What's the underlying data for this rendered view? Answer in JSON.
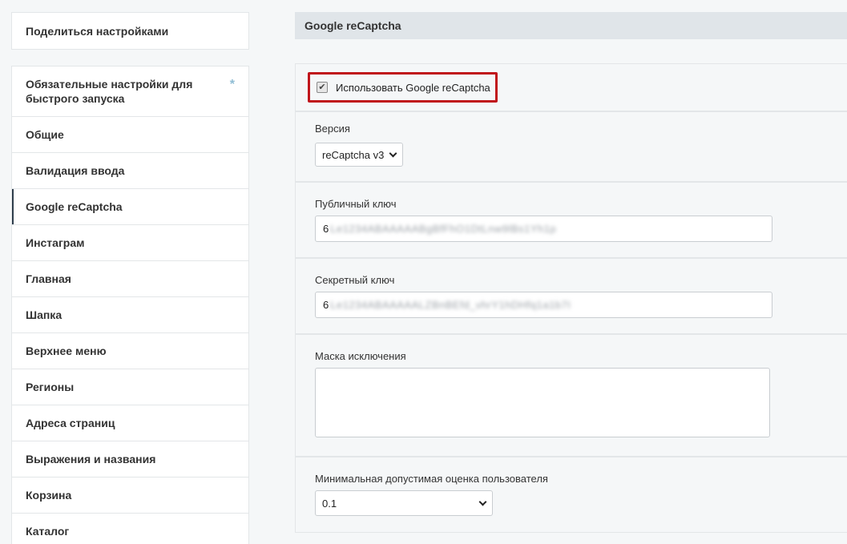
{
  "sidebar": {
    "share_label": "Поделиться настройками",
    "items": [
      {
        "label": "Обязательные настройки для быстрого запуска",
        "marker": "*"
      },
      {
        "label": "Общие"
      },
      {
        "label": "Валидация ввода"
      },
      {
        "label": "Google reCaptcha",
        "active": true
      },
      {
        "label": "Инстаграм"
      },
      {
        "label": "Главная"
      },
      {
        "label": "Шапка"
      },
      {
        "label": "Верхнее меню"
      },
      {
        "label": "Регионы"
      },
      {
        "label": "Адреса страниц"
      },
      {
        "label": "Выражения и названия"
      },
      {
        "label": "Корзина"
      },
      {
        "label": "Каталог"
      }
    ]
  },
  "main": {
    "section_title": "Google reCaptcha",
    "use_recaptcha": {
      "label": "Использовать Google reCaptcha",
      "checked": true
    },
    "version": {
      "label": "Версия",
      "value": "reCaptcha v3"
    },
    "public_key": {
      "label": "Публичный ключ",
      "value_prefix": "6",
      "value_masked": "Le1234ABAAAAABgBfFhO1DtLnw9lBs1Yh1p"
    },
    "secret_key": {
      "label": "Секретный ключ",
      "value_prefix": "6",
      "value_masked": "Le1234ABAAAAALZBnBEfd_vhrY1hDHfq1a1b7I"
    },
    "exclusion_mask": {
      "label": "Маска исключения",
      "value": ""
    },
    "min_score": {
      "label": "Минимальная допустимая оценка пользователя",
      "value": "0.1"
    }
  },
  "colors": {
    "highlight_border": "#c0151b",
    "header_bg": "#e0e5e9",
    "page_bg": "#f5f7f8"
  }
}
